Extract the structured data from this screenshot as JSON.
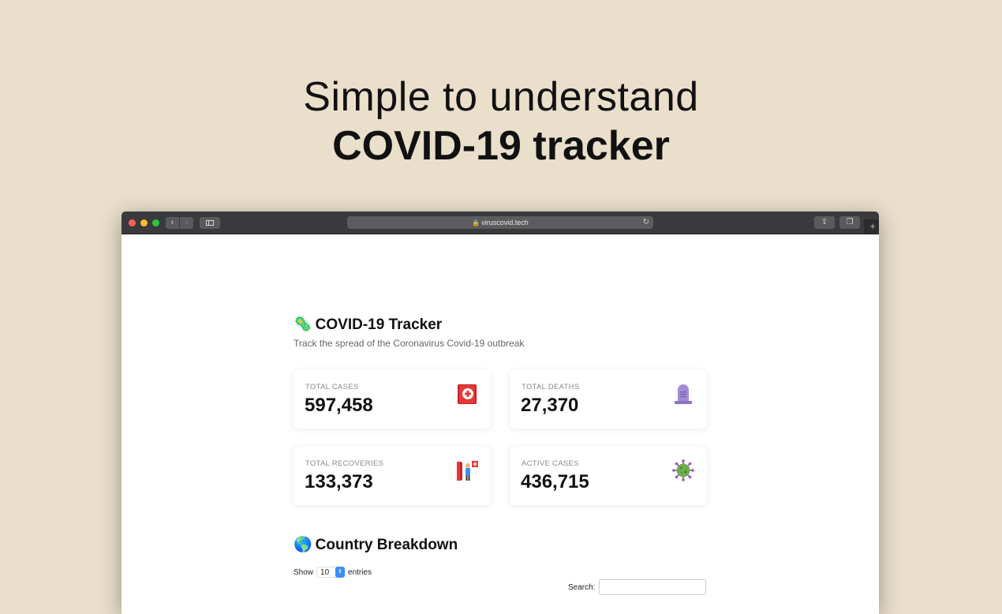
{
  "hero": {
    "line1": "Simple to understand",
    "line2": "COVID-19 tracker"
  },
  "browser": {
    "url": "viruscovid.tech"
  },
  "app": {
    "title": "COVID-19 Tracker",
    "subtitle": "Track the spread of the Coronavirus Covid-19 outbreak"
  },
  "stats": [
    {
      "label": "TOTAL CASES",
      "value": "597,458",
      "icon": "first-aid-kit-icon"
    },
    {
      "label": "TOTAL DEATHS",
      "value": "27,370",
      "icon": "headstone-icon"
    },
    {
      "label": "TOTAL RECOVERIES",
      "value": "133,373",
      "icon": "person-leaving-hospital-icon"
    },
    {
      "label": "ACTIVE CASES",
      "value": "436,715",
      "icon": "virus-icon"
    }
  ],
  "breakdown": {
    "title": "Country Breakdown",
    "show_label": "Show",
    "entries_value": "10",
    "entries_label": "entries",
    "search_label": "Search:",
    "search_value": ""
  },
  "colors": {
    "background": "#eadfcb",
    "titlebar": "#3a3a3c",
    "accent": "#3a8ff5"
  }
}
